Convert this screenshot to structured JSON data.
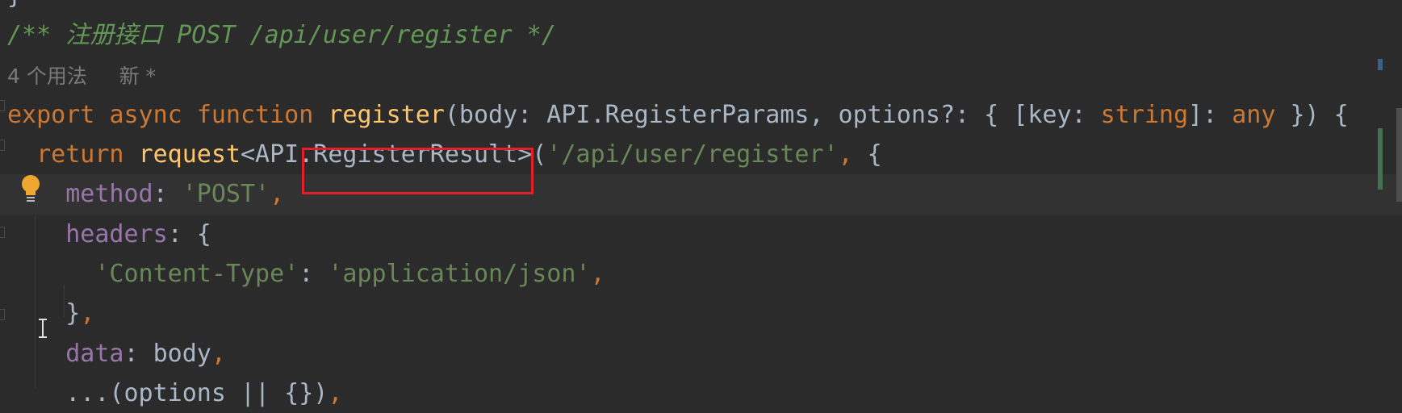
{
  "editor": {
    "lines": [
      {
        "tokens": [
          [
            "}",
            "def"
          ]
        ]
      },
      {
        "tokens": [
          [
            "/** 注册接口 POST /api/user/register */",
            "cmt"
          ]
        ]
      },
      {
        "tokens": [
          [
            "4 个用法",
            "inlay"
          ],
          [
            "     ",
            "inlay"
          ],
          [
            "新 *",
            "inlay"
          ]
        ]
      },
      {
        "tokens": [
          [
            "export ",
            "kw"
          ],
          [
            "async ",
            "kw"
          ],
          [
            "function ",
            "kw"
          ],
          [
            "register",
            "fn"
          ],
          [
            "(body: API.RegisterParams, options?: { [key: ",
            "def"
          ],
          [
            "string",
            "kw"
          ],
          [
            "]: ",
            "def"
          ],
          [
            "any",
            "kw"
          ],
          [
            " }) {",
            "def"
          ]
        ]
      },
      {
        "tokens": [
          [
            "  ",
            "def"
          ],
          [
            "return ",
            "kw"
          ],
          [
            "request",
            "fn"
          ],
          [
            "<API.RegisterResult>(",
            "def"
          ],
          [
            "'/api/user/register'",
            "str"
          ],
          [
            ", ",
            "punc"
          ],
          [
            "{",
            "def"
          ]
        ]
      },
      {
        "current": true,
        "tokens": [
          [
            "    ",
            "def"
          ],
          [
            "method",
            "prop"
          ],
          [
            ": ",
            "def"
          ],
          [
            "'POST'",
            "str"
          ],
          [
            ",",
            "punc"
          ]
        ]
      },
      {
        "tokens": [
          [
            "    ",
            "def"
          ],
          [
            "headers",
            "prop"
          ],
          [
            ": {",
            "def"
          ]
        ]
      },
      {
        "tokens": [
          [
            "      ",
            "def"
          ],
          [
            "'Content-Type'",
            "str"
          ],
          [
            ": ",
            "def"
          ],
          [
            "'application/json'",
            "str"
          ],
          [
            ",",
            "punc"
          ]
        ]
      },
      {
        "tokens": [
          [
            "    ",
            "def"
          ],
          [
            "}",
            "def"
          ],
          [
            ",",
            "punc"
          ]
        ]
      },
      {
        "tokens": [
          [
            "    ",
            "def"
          ],
          [
            "data",
            "prop"
          ],
          [
            ": body",
            "def"
          ],
          [
            ",",
            "punc"
          ]
        ]
      },
      {
        "tokens": [
          [
            "    ",
            "def"
          ],
          [
            "...(options || {})",
            "def"
          ],
          [
            ",",
            "punc"
          ]
        ]
      }
    ]
  },
  "annotations": {
    "highlight_color": "#e3202a",
    "highlighted_text": "RegisterResult>"
  },
  "gutter": {
    "intention_icon": "lightbulb-icon",
    "bulb_color": "#f0a732"
  },
  "colors": {
    "background": "#2b2b2b",
    "keyword": "#cc7832",
    "function": "#ffc66d",
    "string": "#6a8759",
    "comment": "#629755",
    "property": "#9876aa"
  }
}
